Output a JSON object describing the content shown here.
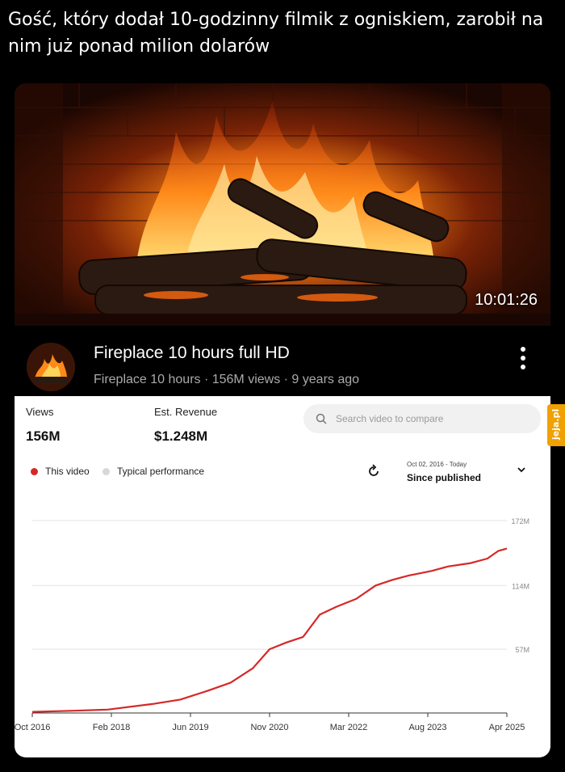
{
  "headline": "Gość, który dodał 10-godzinny filmik z ogniskiem, zarobił na nim już ponad milion dolarów",
  "video": {
    "duration": "10:01:26",
    "title": "Fireplace 10 hours full HD",
    "meta": "Fireplace 10 hours · 156M views · 9 years ago"
  },
  "stats": {
    "views_label": "Views",
    "views_value": "156M",
    "revenue_label": "Est. Revenue",
    "revenue_value": "$1.248M"
  },
  "search": {
    "placeholder": "Search video to compare"
  },
  "legend": {
    "this_video": "This video",
    "typical": "Typical performance"
  },
  "date_range": {
    "range": "Oct 02, 2016 - Today",
    "label": "Since published"
  },
  "watermark": "jeja.pl",
  "colors": {
    "line": "#d62828",
    "accent_dot": "#d62828",
    "typical_dot": "#d8d8d8"
  },
  "chart_data": {
    "type": "line",
    "title": "",
    "xlabel": "",
    "ylabel": "",
    "x_ticks": [
      "Oct 2016",
      "Feb 2018",
      "Jun 2019",
      "Nov 2020",
      "Mar 2022",
      "Aug 2023",
      "Apr 2025"
    ],
    "y_ticks": [
      "57M",
      "114M",
      "172M"
    ],
    "ylim": [
      0,
      172
    ],
    "grid": true,
    "series": [
      {
        "name": "This video",
        "x": [
          2016.75,
          2017.5,
          2018.1,
          2018.9,
          2019.4,
          2019.9,
          2020.3,
          2020.7,
          2021.0,
          2021.3,
          2021.6,
          2021.9,
          2022.2,
          2022.55,
          2022.9,
          2023.2,
          2023.5,
          2023.9,
          2024.2,
          2024.6,
          2024.9,
          2025.1,
          2025.25
        ],
        "values": [
          1,
          2,
          3,
          8,
          12,
          20,
          27,
          40,
          57,
          63,
          68,
          88,
          95,
          102,
          114,
          119,
          123,
          127,
          131,
          134,
          138,
          145,
          147
        ]
      }
    ]
  }
}
